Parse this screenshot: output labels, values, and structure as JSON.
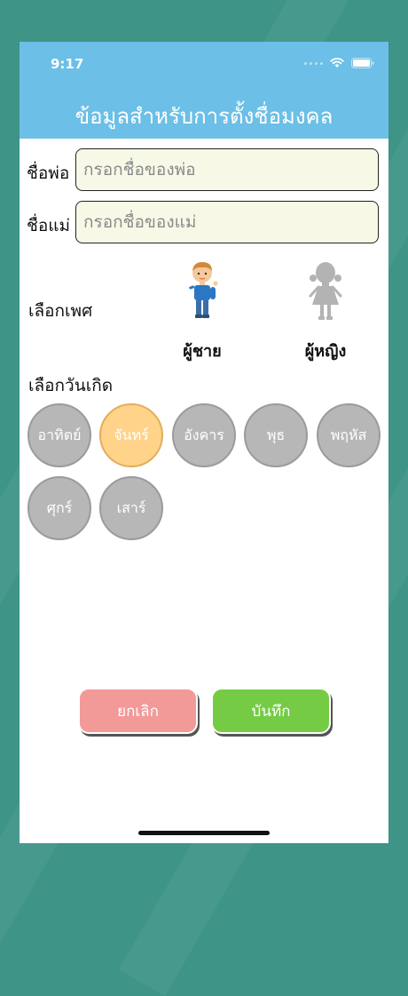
{
  "status_bar": {
    "time": "9:17"
  },
  "header": {
    "title": "ข้อมูลสำหรับการตั้งชื่อมงคล"
  },
  "form": {
    "father_label": "ชื่อพ่อ",
    "father_placeholder": "กรอกชื่อของพ่อ",
    "mother_label": "ชื่อแม่",
    "mother_placeholder": "กรอกชื่อของแม่"
  },
  "gender": {
    "label": "เลือกเพศ",
    "options": [
      {
        "label": "ผู้ชาย",
        "icon": "boy-icon",
        "selected": true
      },
      {
        "label": "ผู้หญิง",
        "icon": "girl-icon",
        "selected": false
      }
    ]
  },
  "birthday": {
    "label": "เลือกวันเกิด",
    "days": [
      "อาทิตย์",
      "จันทร์",
      "อังคาร",
      "พุธ",
      "พฤหัส",
      "ศุกร์",
      "เสาร์"
    ],
    "selected_day": "จันทร์"
  },
  "actions": {
    "cancel": "ยกเลิก",
    "save": "บันทึก"
  },
  "colors": {
    "header": "#6cbfe6",
    "day_default": "#b7b7b7",
    "day_selected": "#ffd389",
    "cancel": "#f29a98",
    "save": "#75cc44"
  }
}
